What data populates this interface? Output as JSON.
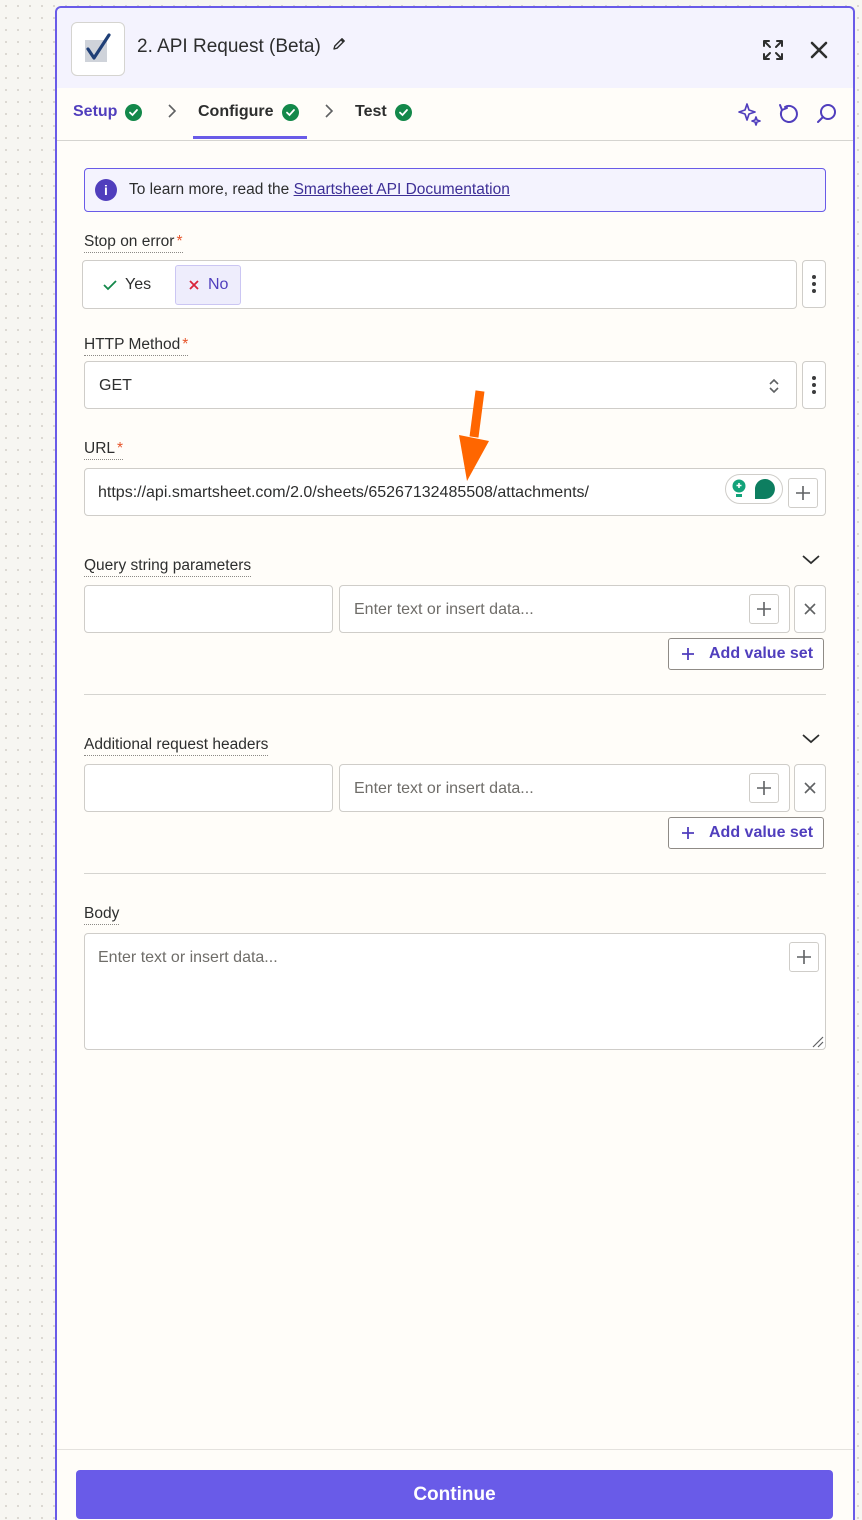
{
  "header": {
    "title": "2. API Request (Beta)",
    "app_icon": "smartsheet-checkmark-icon",
    "actions": [
      "expand-icon",
      "close-icon"
    ]
  },
  "tabs": [
    {
      "label": "Setup",
      "status": "complete"
    },
    {
      "label": "Configure",
      "status": "complete",
      "active": true
    },
    {
      "label": "Test",
      "status": "complete"
    }
  ],
  "toolbar_icons": [
    "sparkle-icon",
    "refresh-icon",
    "search-icon"
  ],
  "info_banner": {
    "text": "To learn more, read the",
    "link": "Smartsheet API Documentation"
  },
  "stop_on_error": {
    "label": "Stop on error",
    "required_mark": "*",
    "yes_label": "Yes",
    "no_label": "No",
    "selected": "No"
  },
  "http_method": {
    "label": "HTTP Method",
    "required_mark": "*",
    "value": "GET"
  },
  "url": {
    "label": "URL",
    "required_mark": "*",
    "value": "https://api.smartsheet.com/2.0/sheets/65267132485508/attachments/"
  },
  "query_params": {
    "label": "Query string parameters",
    "value_placeholder": "Enter text or insert data...",
    "add_label": "Add value set"
  },
  "headers": {
    "label": "Additional request headers",
    "value_placeholder": "Enter text or insert data...",
    "add_label": "Add value set"
  },
  "body": {
    "label": "Body",
    "placeholder": "Enter text or insert data..."
  },
  "footer": {
    "continue_label": "Continue"
  },
  "colors": {
    "accent": "#695be8",
    "success": "#13884a",
    "annotation_arrow": "#ff6600"
  }
}
